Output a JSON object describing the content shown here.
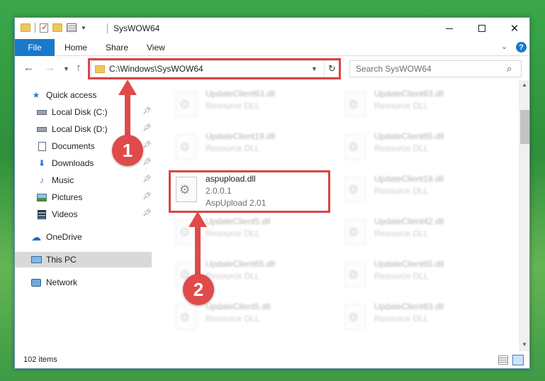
{
  "window": {
    "title": "SysWOW64"
  },
  "ribbon": {
    "tabs": [
      "File",
      "Home",
      "Share",
      "View"
    ]
  },
  "address": {
    "path": "C:\\Windows\\SysWOW64"
  },
  "search": {
    "placeholder": "Search SysWOW64"
  },
  "nav": {
    "items": [
      {
        "label": "Quick access",
        "icon": "star-icon"
      },
      {
        "label": "Local Disk (C:)",
        "icon": "drive-icon",
        "pinned": true
      },
      {
        "label": "Local Disk (D:)",
        "icon": "drive-icon",
        "pinned": true
      },
      {
        "label": "Documents",
        "icon": "documents-icon",
        "pinned": true
      },
      {
        "label": "Downloads",
        "icon": "download-icon",
        "pinned": true
      },
      {
        "label": "Music",
        "icon": "music-icon",
        "pinned": true
      },
      {
        "label": "Pictures",
        "icon": "pictures-icon",
        "pinned": true
      },
      {
        "label": "Videos",
        "icon": "videos-icon",
        "pinned": true
      },
      {
        "label": "OneDrive",
        "icon": "cloud-icon"
      },
      {
        "label": "This PC",
        "icon": "computer-icon",
        "selected": true
      },
      {
        "label": "Network",
        "icon": "network-icon"
      }
    ]
  },
  "files": {
    "highlighted": {
      "name": "aspupload.dll",
      "version": "2.0.0.1",
      "description": "AspUpload 2.01"
    },
    "faded": [
      {
        "name": "UpdateClient63.dll",
        "type": "Resource DLL"
      },
      {
        "name": "UpdateClient63.dll",
        "type": "Resource DLL"
      },
      {
        "name": "UpdateClient19.dll",
        "type": "Resource DLL"
      },
      {
        "name": "UpdateClient65.dll",
        "type": "Resource DLL"
      },
      {
        "name": "UpdateClient19.dll",
        "type": "Resource DLL"
      },
      {
        "name": "UpdateClient5.dll",
        "type": "Resource DLL"
      },
      {
        "name": "UpdateClient42.dll",
        "type": "Resource DLL"
      },
      {
        "name": "UpdateClient65.dll",
        "type": "Resource DLL"
      },
      {
        "name": "UpdateClient65.dll",
        "type": "Resource DLL"
      },
      {
        "name": "UpdateClient5.dll",
        "type": "Resource DLL"
      },
      {
        "name": "UpdateClient63.dll",
        "type": "Resource DLL"
      }
    ]
  },
  "status": {
    "count": "102 items"
  },
  "annotations": {
    "step1": "1",
    "step2": "2"
  },
  "colors": {
    "accent": "#1979ca",
    "highlight": "#d94545"
  }
}
